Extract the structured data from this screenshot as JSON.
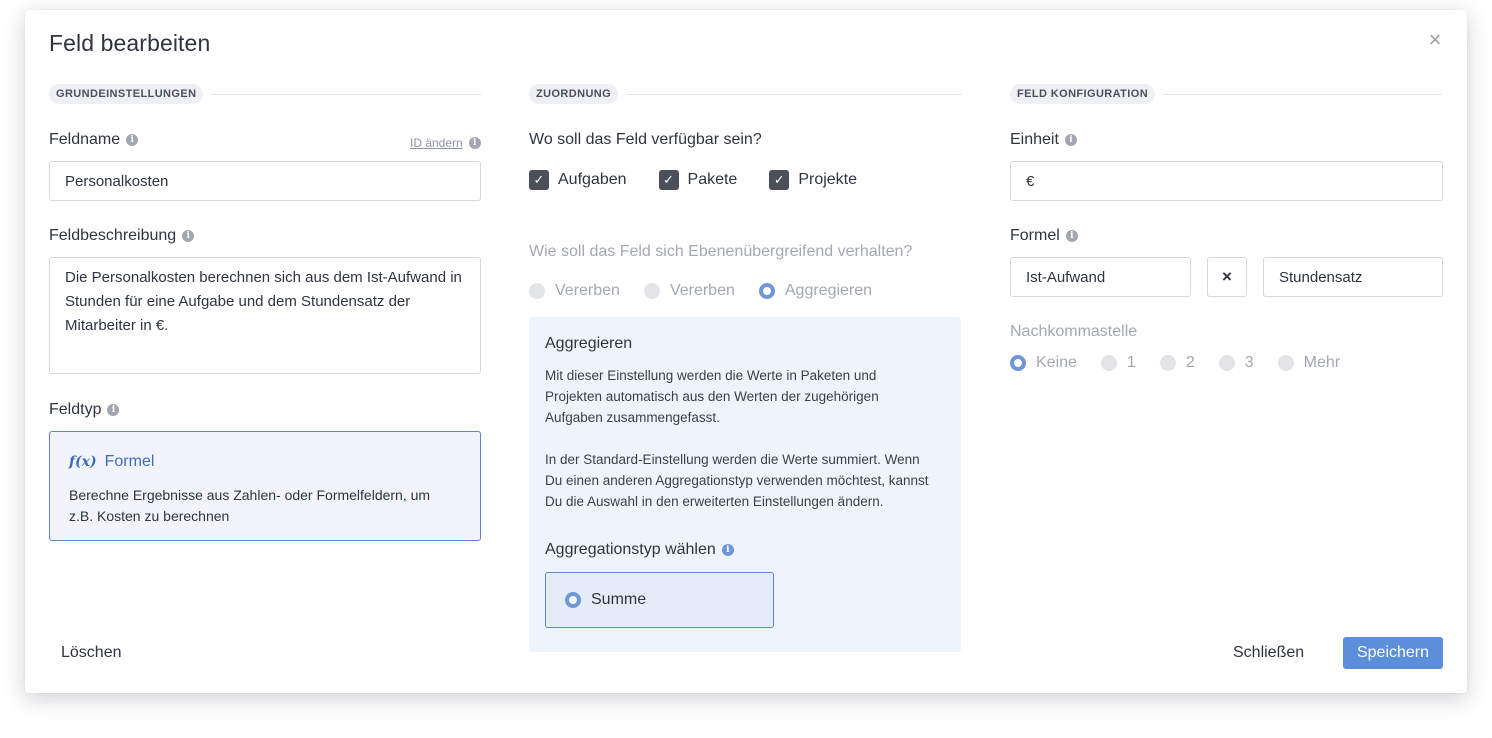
{
  "modal": {
    "title": "Feld bearbeiten",
    "close_symbol": "×"
  },
  "sections": {
    "basic": "GRUNDEINSTELLUNGEN",
    "mapping": "ZUORDNUNG",
    "config": "FELD KONFIGURATION"
  },
  "basic": {
    "fieldname_label": "Feldname",
    "change_id_link": "ID ändern",
    "fieldname_value": "Personalkosten",
    "description_label": "Feldbeschreibung",
    "description_value": "Die Personalkosten berechnen sich aus dem Ist-Aufwand in Stunden für eine Aufgabe und dem Stundensatz der Mitarbeiter in €.",
    "fieldtype_label": "Feldtyp",
    "fieldtype": {
      "icon_text": "f(x)",
      "title": "Formel",
      "description": "Berechne Ergebnisse aus Zahlen- oder Formelfeldern, um z.B. Kosten zu berechnen"
    }
  },
  "mapping": {
    "availability_question": "Wo soll das Feld verfügbar sein?",
    "checkboxes": [
      {
        "label": "Aufgaben",
        "checked": true
      },
      {
        "label": "Pakete",
        "checked": true
      },
      {
        "label": "Projekte",
        "checked": true
      }
    ],
    "behavior_question": "Wie soll das Feld sich Ebenenübergreifend verhalten?",
    "behavior_options": [
      {
        "label": "Vererben",
        "selected": false
      },
      {
        "label": "Vererben",
        "selected": false
      },
      {
        "label": "Aggregieren",
        "selected": true
      }
    ],
    "aggregate_panel": {
      "title": "Aggregieren",
      "paragraph_1": "Mit dieser Einstellung werden die Werte in Paketen und Projekten automatisch aus den Werten der zugehörigen Aufgaben zusammengefasst.",
      "paragraph_2": "In der Standard-Einstellung werden die Werte summiert. Wenn Du einen anderen Aggregationstyp verwenden möchtest, kannst Du die Auswahl in den erweiterten Einstellungen ändern.",
      "type_label": "Aggregationstyp wählen",
      "selected_type": "Summe"
    }
  },
  "config": {
    "unit_label": "Einheit",
    "unit_value": "€",
    "formula_label": "Formel",
    "formula_left": "Ist-Aufwand",
    "formula_operator": "×",
    "formula_right": "Stundensatz",
    "decimals_label": "Nachkommastelle",
    "decimal_options": [
      {
        "label": "Keine",
        "selected": true
      },
      {
        "label": "1",
        "selected": false
      },
      {
        "label": "2",
        "selected": false
      },
      {
        "label": "3",
        "selected": false
      },
      {
        "label": "Mehr",
        "selected": false
      }
    ]
  },
  "footer": {
    "delete_label": "Löschen",
    "close_label": "Schließen",
    "save_label": "Speichern"
  },
  "colors": {
    "accent": "#5b8fd9",
    "accent_border": "#5b86c9",
    "panel_bg": "#eff4fc",
    "checkbox": "#4a4f5a"
  }
}
